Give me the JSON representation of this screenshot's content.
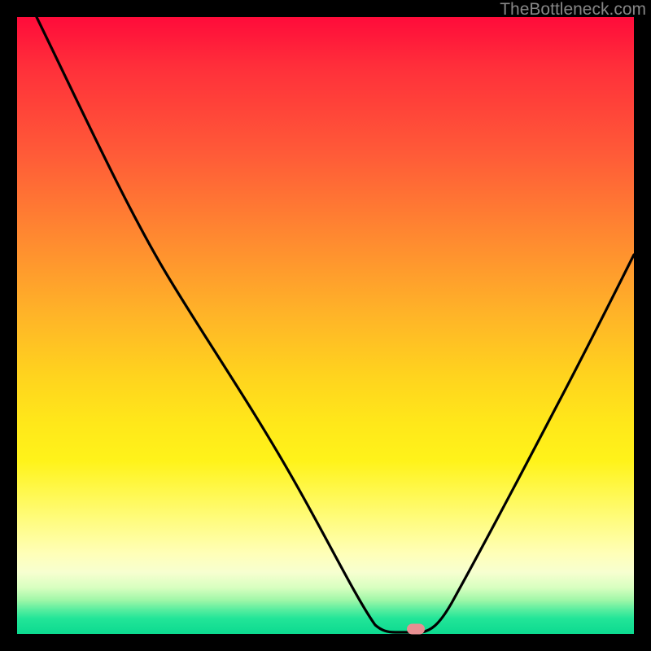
{
  "watermark": {
    "text": "TheBottleneck.com"
  },
  "chart_data": {
    "type": "line",
    "title": "",
    "xlabel": "",
    "ylabel": "",
    "xlim": [
      0,
      100
    ],
    "ylim": [
      0,
      100
    ],
    "grid": false,
    "series": [
      {
        "name": "bottleneck-curve",
        "x": [
          3,
          10,
          18,
          24,
          30,
          37,
          45,
          52,
          58,
          62,
          66,
          70,
          76,
          82,
          88,
          94,
          100
        ],
        "y": [
          100,
          85,
          70,
          58,
          48,
          37,
          24,
          12,
          4,
          0,
          0,
          3,
          13,
          26,
          38,
          50,
          62
        ]
      }
    ],
    "annotations": [
      {
        "name": "optimal-point",
        "x": 64,
        "y": 0,
        "shape": "pill",
        "color": "#e88f92"
      }
    ],
    "background_gradient": {
      "direction": "vertical",
      "stops": [
        {
          "pos": 0.0,
          "color": "#ff0b3a"
        },
        {
          "pos": 0.35,
          "color": "#ff8a30"
        },
        {
          "pos": 0.65,
          "color": "#ffe81a"
        },
        {
          "pos": 0.88,
          "color": "#ffffb8"
        },
        {
          "pos": 1.0,
          "color": "#0cda90"
        }
      ]
    }
  }
}
